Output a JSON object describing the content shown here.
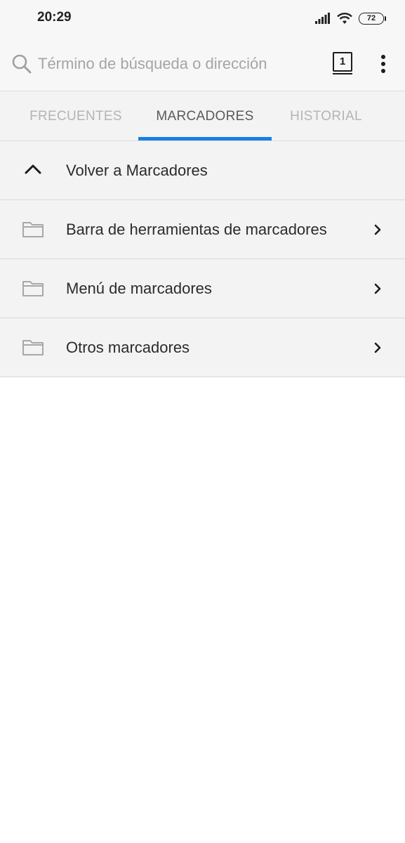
{
  "status_bar": {
    "time": "20:29",
    "battery": "72",
    "icons": [
      "signal-icon",
      "wifi-icon",
      "battery-icon"
    ]
  },
  "url_bar": {
    "placeholder": "Término de búsqueda o dirección",
    "tab_count": "1"
  },
  "tabs": [
    {
      "label": "FRECUENTES",
      "active": false
    },
    {
      "label": "MARCADORES",
      "active": true
    },
    {
      "label": "HISTORIAL",
      "active": false
    }
  ],
  "bookmarks": {
    "back_label": "Volver a Marcadores",
    "folders": [
      {
        "label": "Barra de herramientas de marcadores"
      },
      {
        "label": "Menú de marcadores"
      },
      {
        "label": "Otros marcadores"
      }
    ]
  },
  "colors": {
    "accent": "#1a7ee6",
    "row_background": "#f3f3f3",
    "inactive_tab": "#b4b4b4"
  }
}
